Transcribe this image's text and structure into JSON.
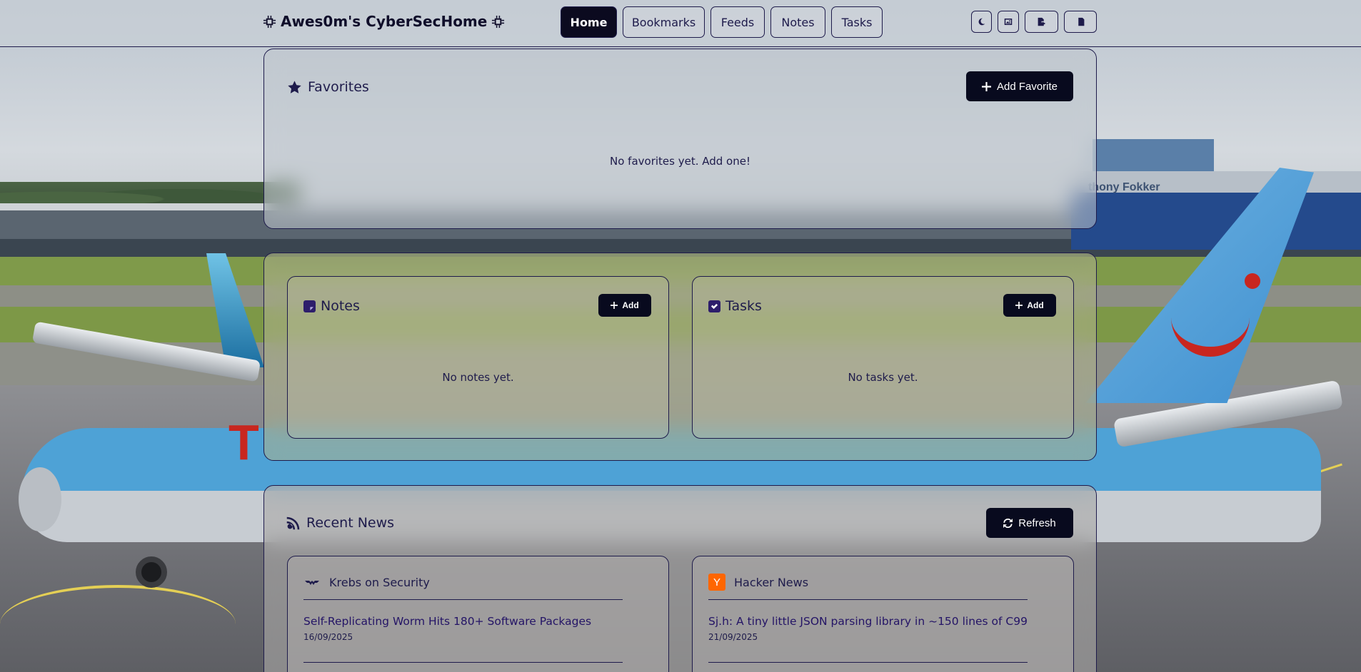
{
  "header": {
    "brand": "Awes0m's CyberSecHome",
    "tabs": [
      {
        "label": "Home",
        "active": true
      },
      {
        "label": "Bookmarks",
        "active": false
      },
      {
        "label": "Feeds",
        "active": false
      },
      {
        "label": "Notes",
        "active": false
      },
      {
        "label": "Tasks",
        "active": false
      }
    ],
    "icons": [
      "moon-icon",
      "image-icon",
      "export-icon",
      "import-icon"
    ]
  },
  "favorites": {
    "title": "Favorites",
    "add_label": "Add Favorite",
    "empty": "No favorites yet. Add one!"
  },
  "notes": {
    "title": "Notes",
    "add_label": "Add",
    "empty": "No notes yet."
  },
  "tasks": {
    "title": "Tasks",
    "add_label": "Add",
    "empty": "No tasks yet."
  },
  "news": {
    "title": "Recent News",
    "refresh_label": "Refresh",
    "sources": [
      {
        "name": "Krebs on Security",
        "icon": "krebs-logo-icon",
        "articles": [
          {
            "title": "Self-Replicating Worm Hits 180+ Software Packages",
            "date": "16/09/2025"
          }
        ]
      },
      {
        "name": "Hacker News",
        "icon": "hacker-news-icon",
        "icon_letter": "Y",
        "articles": [
          {
            "title": "Sj.h: A tiny little JSON parsing library in ~150 lines of C99",
            "date": "21/09/2025"
          }
        ]
      }
    ]
  },
  "background": {
    "text": "thony Fokker"
  },
  "colors": {
    "primary": "#080a1e",
    "accent": "#1e1b4b",
    "hn_orange": "#ff6600"
  }
}
